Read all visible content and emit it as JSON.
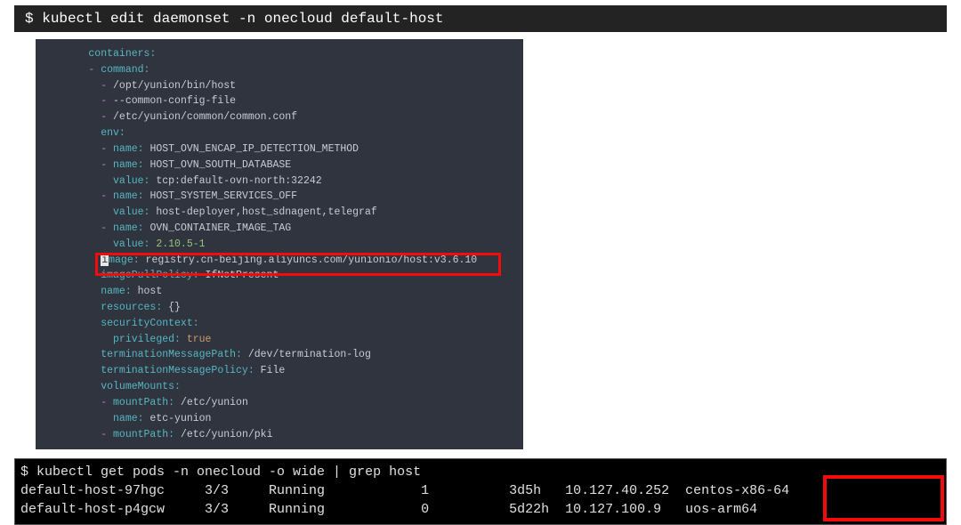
{
  "cmd1": {
    "prompt": "$",
    "text": "kubectl edit daemonset -n onecloud default-host"
  },
  "yaml": {
    "l1": "      containers:",
    "l2d": "      -",
    "l2k": " command:",
    "l3d": "        -",
    "l3v": " /opt/yunion/bin/host",
    "l4d": "        -",
    "l4v": " --common-config-file",
    "l5d": "        -",
    "l5v": " /etc/yunion/common/common.conf",
    "l6": "        env:",
    "l7d": "        -",
    "l7k": " name:",
    "l7v": " HOST_OVN_ENCAP_IP_DETECTION_METHOD",
    "l8d": "        -",
    "l8k": " name:",
    "l8v": " HOST_OVN_SOUTH_DATABASE",
    "l9k": "          value:",
    "l9v": " tcp:default-ovn-north:32242",
    "l10d": "        -",
    "l10k": " name:",
    "l10v": " HOST_SYSTEM_SERVICES_OFF",
    "l11k": "          value:",
    "l11v": " host-deployer,host_sdnagent,telegraf",
    "l12d": "        -",
    "l12k": " name:",
    "l12v": " OVN_CONTAINER_IMAGE_TAG",
    "l13k": "          value:",
    "l13v": " 2.10.5-1",
    "l14c": "i",
    "l14k": "mage:",
    "l14v": " registry.cn-beijing.aliyuncs.com/yunionio/host:v3.6.10",
    "l15k": "        imagePullPolicy:",
    "l15v": " IfNotPresent",
    "l16k": "        name:",
    "l16v": " host",
    "l17k": "        resources:",
    "l17v": " {}",
    "l18k": "        securityContext:",
    "l19k": "          privileged:",
    "l19v": " true",
    "l20k": "        terminationMessagePath:",
    "l20v": " /dev/termination-log",
    "l21k": "        terminationMessagePolicy:",
    "l21v": " File",
    "l22k": "        volumeMounts:",
    "l23d": "        -",
    "l23k": " mountPath:",
    "l23v": " /etc/yunion",
    "l24k": "          name:",
    "l24v": " etc-yunion",
    "l25d": "        -",
    "l25k": " mountPath:",
    "l25v": " /etc/yunion/pki"
  },
  "term": {
    "row0": "$ kubectl get pods -n onecloud -o wide | grep host",
    "row1": "default-host-97hgc     3/3     Running            1          3d5h   10.127.40.252  centos-x86-64",
    "row2": "default-host-p4gcw     3/3     Running            0          5d22h  10.127.100.9   uos-arm64"
  }
}
